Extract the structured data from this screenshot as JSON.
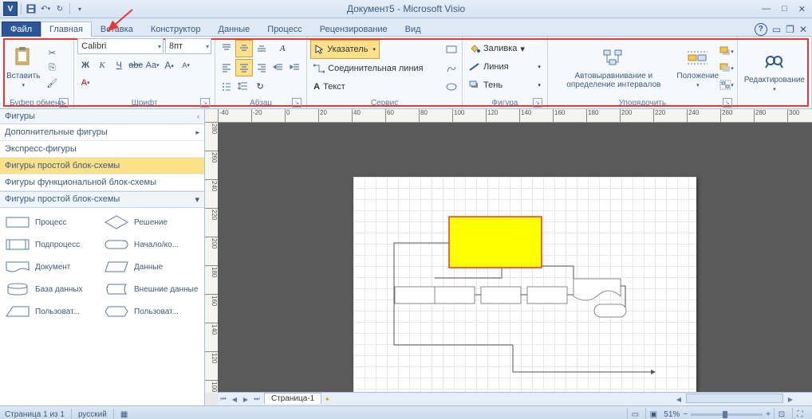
{
  "title": "Документ5  -  Microsoft Visio",
  "tabs": {
    "file": "Файл",
    "home": "Главная",
    "insert": "Вставка",
    "design": "Конструктор",
    "data": "Данные",
    "process": "Процесс",
    "review": "Рецензирование",
    "view": "Вид"
  },
  "ribbon": {
    "clipboard": {
      "label": "Буфер обмена",
      "paste": "Вставить"
    },
    "font": {
      "label": "Шрифт",
      "name": "Calibri",
      "size": "8пт"
    },
    "paragraph": {
      "label": "Абзац"
    },
    "tools": {
      "label": "Сервис",
      "pointer": "Указатель",
      "connector": "Соединительная линия",
      "text": "Текст"
    },
    "shape": {
      "label": "Фигура",
      "fill": "Заливка",
      "line": "Линия",
      "shadow": "Тень"
    },
    "arrange": {
      "label": "Упорядочить",
      "auto": "Автовыравнивание и определение интервалов",
      "position": "Положение"
    },
    "editing": {
      "label": "Редактирование"
    }
  },
  "shapes_pane": {
    "title": "Фигуры",
    "more": "Дополнительные фигуры",
    "quick": "Экспресс-фигуры",
    "basic": "Фигуры простой блок-схемы",
    "func": "Фигуры функциональной блок-схемы",
    "section": "Фигуры простой блок-схемы",
    "items": [
      {
        "n": "Процесс"
      },
      {
        "n": "Решение"
      },
      {
        "n": "Подпроцесс"
      },
      {
        "n": "Начало/ко..."
      },
      {
        "n": "Документ"
      },
      {
        "n": "Данные"
      },
      {
        "n": "База данных"
      },
      {
        "n": "Внешние данные"
      },
      {
        "n": "Пользоват..."
      },
      {
        "n": "Пользоват..."
      }
    ]
  },
  "ruler_h": [
    "-40",
    "-20",
    "0",
    "20",
    "40",
    "60",
    "80",
    "100",
    "120",
    "140",
    "160",
    "180",
    "200",
    "220",
    "240",
    "260",
    "280",
    "300"
  ],
  "ruler_v": [
    "280",
    "260",
    "240",
    "220",
    "200",
    "180",
    "160",
    "140",
    "120",
    "100"
  ],
  "page_tab": "Страница-1",
  "status": {
    "page": "Страница 1 из 1",
    "lang": "русский",
    "zoom": "51%"
  }
}
